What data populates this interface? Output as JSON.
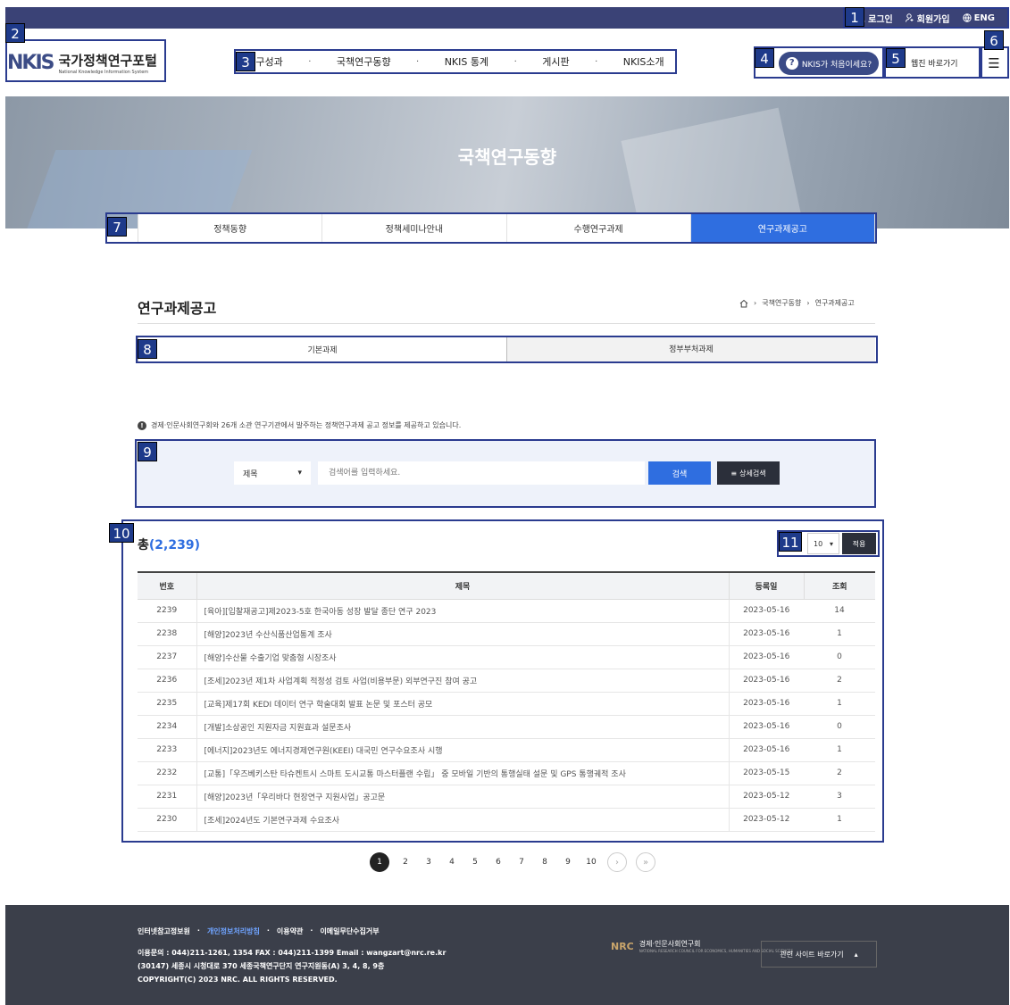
{
  "annotations": [
    "1",
    "2",
    "3",
    "4",
    "5",
    "6",
    "7",
    "8",
    "9",
    "10",
    "11"
  ],
  "util": {
    "login": "로그인",
    "signup": "회원가입",
    "eng": "ENG"
  },
  "logo": {
    "mark": "NKIS",
    "main": "국가정책연구포털",
    "sub": "National Knowledge Information System"
  },
  "gnb": [
    "연구성과",
    "국책연구동향",
    "NKIS 통계",
    "게시판",
    "NKIS소개"
  ],
  "nkis_btn": {
    "q": "?",
    "label": "NKIS가 처음이세요?"
  },
  "webzine": "웹진 바로가기",
  "menu_icon": "☰",
  "hero": {
    "title": "국책연구동향"
  },
  "subtabs": [
    "정책동향",
    "정책세미나안내",
    "수행연구과제",
    "연구과제공고"
  ],
  "page_title": "연구과제공고",
  "breadcrumb": {
    "level1": "국책연구동향",
    "level2": "연구과제공고"
  },
  "subtabs2": [
    "기본과제",
    "정부부처과제"
  ],
  "notice": "경제·인문사회연구회와 26개 소관 연구기관에서 발주하는 정책연구과제 공고 정보를 제공하고 있습니다.",
  "search": {
    "select": "제목",
    "placeholder": "검색어를 입력하세요.",
    "btn": "검색",
    "adv": "상세검색"
  },
  "total": {
    "label": "총",
    "count": "(2,239)"
  },
  "page_size": "10",
  "apply": "적용",
  "table": {
    "headers": [
      "번호",
      "제목",
      "등록일",
      "조회"
    ],
    "rows": [
      [
        "2239",
        "[육아][입찰재공고]제2023-5호 한국아동 성장 발달 종단 연구 2023",
        "2023-05-16",
        "14"
      ],
      [
        "2238",
        "[해양]2023년 수산식품산업통계 조사",
        "2023-05-16",
        "1"
      ],
      [
        "2237",
        "[해양]수산물 수출기업 맞춤형 시장조사",
        "2023-05-16",
        "0"
      ],
      [
        "2236",
        "[조세]2023년 제1차 사업계획 적정성 검토 사업(비용부문) 외부연구진 참여 공고",
        "2023-05-16",
        "2"
      ],
      [
        "2235",
        "[교육]제17회 KEDI 데이터 연구 학술대회 발표 논문 및 포스터 공모",
        "2023-05-16",
        "1"
      ],
      [
        "2234",
        "[개발]소상공인 지원자금 지원효과 설문조사",
        "2023-05-16",
        "0"
      ],
      [
        "2233",
        "[에너지]2023년도 에너지경제연구원(KEEI) 대국민 연구수요조사 시행",
        "2023-05-16",
        "1"
      ],
      [
        "2232",
        "[교통]「우즈베키스탄 타슈켄트시 스마트 도시교통 마스터플랜 수립」 중 모바일 기반의 통행실태 설문 및 GPS 통행궤적 조사",
        "2023-05-15",
        "2"
      ],
      [
        "2231",
        "[해양]2023년「우리바다 현장연구 지원사업」공고문",
        "2023-05-12",
        "3"
      ],
      [
        "2230",
        "[조세]2024년도 기본연구과제 수요조사",
        "2023-05-12",
        "1"
      ]
    ]
  },
  "pager": [
    "1",
    "2",
    "3",
    "4",
    "5",
    "6",
    "7",
    "8",
    "9",
    "10"
  ],
  "footer": {
    "links": [
      "인터넷참고정보원",
      "개인정보처리방침",
      "이용약관",
      "이메일무단수집거부"
    ],
    "contact": "이용문의 : 044)211-1261, 1354     FAX : 044)211-1399     Email : wangzart@nrc.re.kr",
    "address": "(30147) 세종시 시청대로 370 세종국책연구단지 연구지원동(A) 3, 4, 8, 9층",
    "copyright": "COPYRIGHT(C) 2023 NRC. ALL RIGHTS RESERVED.",
    "nrc_mark": "NRC",
    "nrc_name": "경제·인문사회연구회",
    "nrc_sub": "NATIONAL RESEARCH COUNCIL FOR ECONOMICS, HUMANITIES AND SOCIAL SCIENCES",
    "related": "관련 사이트 바로가기"
  }
}
